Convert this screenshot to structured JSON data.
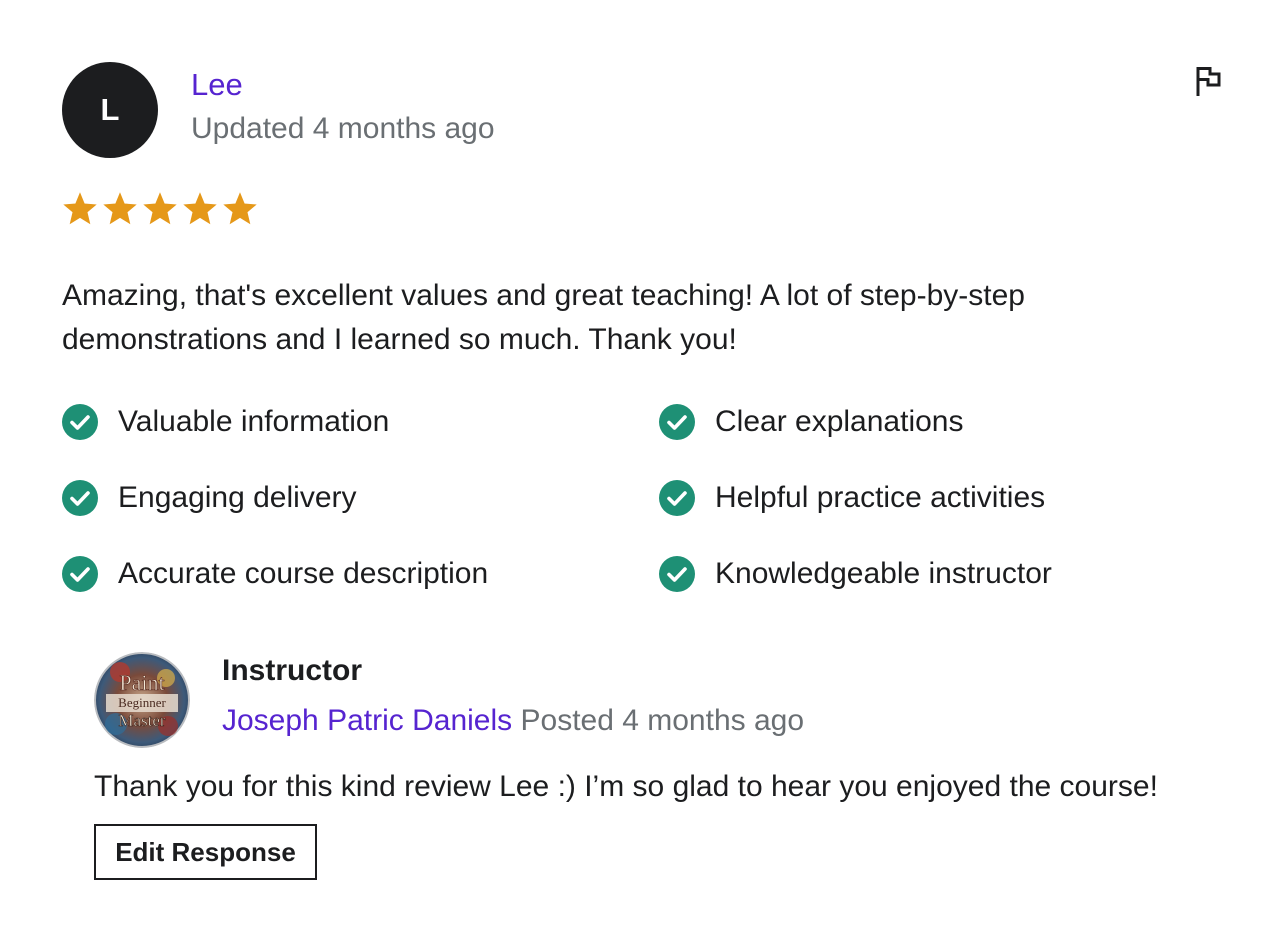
{
  "review": {
    "avatar_initial": "L",
    "reviewer_name": "Lee",
    "date": "Updated 4 months ago",
    "flag_icon": "flag-icon",
    "rating": 5,
    "rating_max": 5,
    "text": "Amazing, that's excellent values and great teaching! A lot of step-by-step demonstrations and I learned so much. Thank you!",
    "tags": [
      {
        "label": "Valuable information"
      },
      {
        "label": "Clear explanations"
      },
      {
        "label": "Engaging delivery"
      },
      {
        "label": "Helpful practice activities"
      },
      {
        "label": "Accurate course description"
      },
      {
        "label": "Knowledgeable instructor"
      }
    ]
  },
  "response": {
    "role": "Instructor",
    "instructor_name": "Joseph Patric Daniels",
    "date": "Posted 4 months ago",
    "avatar_text": [
      "Paint",
      "Beginner",
      "Master"
    ],
    "text": "Thank you for this kind review Lee :) I’m so glad to hear you enjoyed the course!",
    "edit_label": "Edit Response"
  },
  "colors": {
    "link": "#5624d0",
    "muted": "#6a6f73",
    "star": "#e59819",
    "check": "#1e9075",
    "text": "#1c1d1f"
  }
}
